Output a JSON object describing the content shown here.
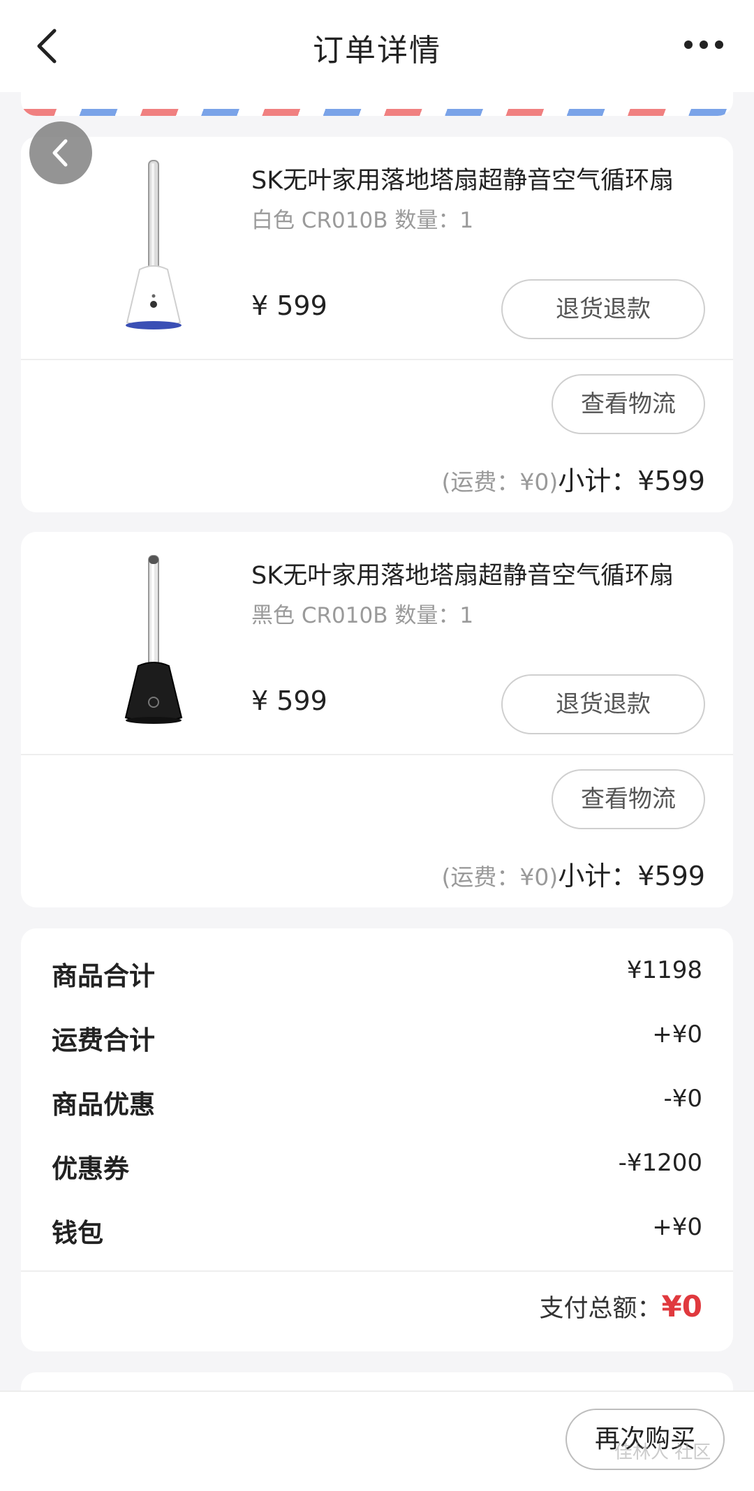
{
  "header": {
    "title": "订单详情",
    "back_icon": "chevron-left-icon",
    "more_icon": "more-dots-icon"
  },
  "colors": {
    "price_red": "#e0393e",
    "stripe_red": "#f08080",
    "stripe_blue": "#7aa3e8"
  },
  "items": [
    {
      "name": "SK无叶家用落地塔扇超静音空气循环扇",
      "spec": "白色 CR010B 数量：1",
      "price": "¥ 599",
      "refund_label": "退货退款",
      "logistics_label": "查看物流",
      "shipping": "(运费：¥0)",
      "subtotal": "小计：¥599"
    },
    {
      "name": "SK无叶家用落地塔扇超静音空气循环扇",
      "spec": "黑色 CR010B 数量：1",
      "price": "¥ 599",
      "refund_label": "退货退款",
      "logistics_label": "查看物流",
      "shipping": "(运费：¥0)",
      "subtotal": "小计：¥599"
    }
  ],
  "summary": {
    "rows": [
      {
        "label": "商品合计",
        "value": "¥1198"
      },
      {
        "label": "运费合计",
        "value": "+¥0"
      },
      {
        "label": "商品优惠",
        "value": "-¥0"
      },
      {
        "label": "优惠券",
        "value": "-¥1200"
      },
      {
        "label": "钱包",
        "value": "+¥0"
      }
    ],
    "total_label": "支付总额：",
    "total_value": "¥0"
  },
  "bottom": {
    "buy_again_label": "再次购买"
  },
  "watermark": "佳林人 社区"
}
